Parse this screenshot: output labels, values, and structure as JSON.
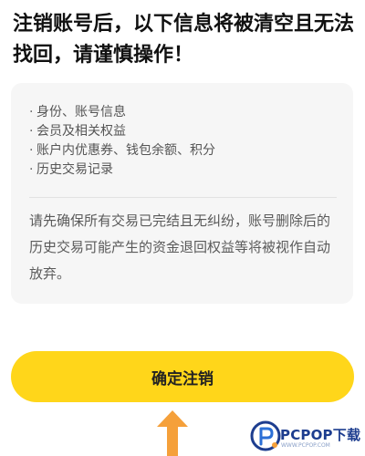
{
  "warning": {
    "title": "注销账号后，以下信息将被清空且无法找回，请谨慎操作！"
  },
  "card": {
    "items": [
      "身份、账号信息",
      "会员及相关权益",
      "账户内优惠券、钱包余额、积分",
      "历史交易记录"
    ],
    "bullet": "·",
    "notice": "请先确保所有交易已完结且无纠纷，账号删除后的历史交易可能产生的资金退回权益等将被视作自动放弃。"
  },
  "confirm": {
    "label": "确定注销"
  },
  "watermark": {
    "brand": "PCPOP下载",
    "sub": "WWW.PCPOP.COM"
  },
  "colors": {
    "accent": "#ffd61a",
    "arrow": "#f5a03a",
    "brand": "#1d3d8f"
  }
}
